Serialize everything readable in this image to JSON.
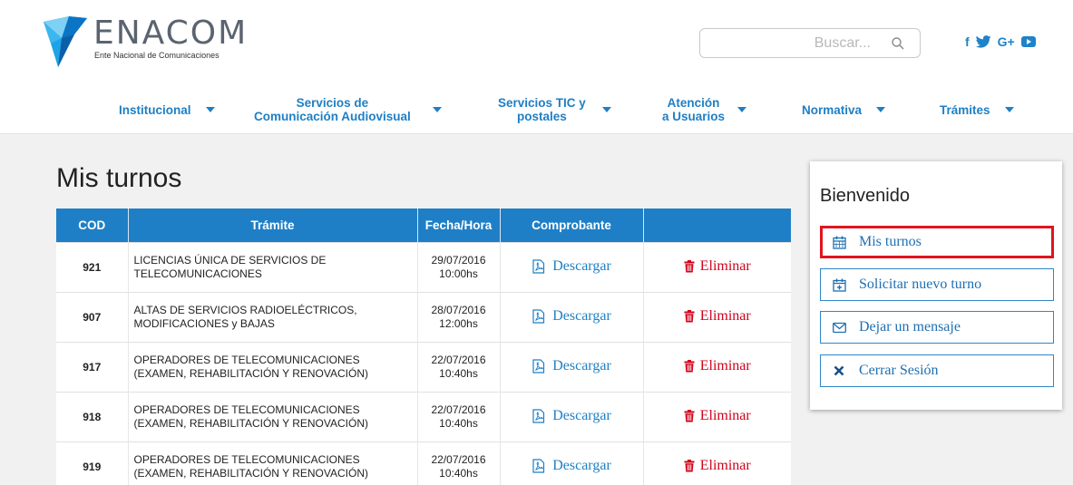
{
  "brand": {
    "name": "ENACOM",
    "subtitle": "Ente Nacional de Comunicaciones",
    "color": "#1e7fc4"
  },
  "search": {
    "placeholder": "Buscar..."
  },
  "social": [
    "f",
    "twitter",
    "G+",
    "youtube"
  ],
  "nav": [
    {
      "label": "Institucional"
    },
    {
      "label": "Servicios de\nComunicación Audiovisual"
    },
    {
      "label": "Servicios TIC y\npostales"
    },
    {
      "label": "Atención\na Usuarios"
    },
    {
      "label": "Normativa"
    },
    {
      "label": "Trámites"
    }
  ],
  "page_title": "Mis turnos",
  "table": {
    "headers": [
      "COD",
      "Trámite",
      "Fecha/Hora",
      "Comprobante",
      ""
    ],
    "download_label": "Descargar",
    "delete_label": "Eliminar",
    "rows": [
      {
        "cod": "921",
        "tramite": "LICENCIAS ÚNICA DE SERVICIOS DE TELECOMUNICACIONES",
        "fecha": "29/07/2016",
        "hora": "10:00hs"
      },
      {
        "cod": "907",
        "tramite": "ALTAS DE SERVICIOS RADIOELÉCTRICOS, MODIFICACIONES y BAJAS",
        "fecha": "28/07/2016",
        "hora": "12:00hs"
      },
      {
        "cod": "917",
        "tramite": "OPERADORES DE TELECOMUNICACIONES (EXAMEN, REHABILITACIÓN Y RENOVACIÓN)",
        "fecha": "22/07/2016",
        "hora": "10:40hs"
      },
      {
        "cod": "918",
        "tramite": "OPERADORES DE TELECOMUNICACIONES (EXAMEN, REHABILITACIÓN Y RENOVACIÓN)",
        "fecha": "22/07/2016",
        "hora": "10:40hs"
      },
      {
        "cod": "919",
        "tramite": "OPERADORES DE TELECOMUNICACIONES (EXAMEN, REHABILITACIÓN Y RENOVACIÓN)",
        "fecha": "22/07/2016",
        "hora": "10:40hs"
      }
    ]
  },
  "panel": {
    "title": "Bienvenido",
    "items": [
      {
        "label": "Mis turnos",
        "icon": "calendar-icon",
        "active": true
      },
      {
        "label": "Solicitar nuevo turno",
        "icon": "calendar-plus-icon",
        "active": false
      },
      {
        "label": "Dejar un mensaje",
        "icon": "envelope-icon",
        "active": false
      },
      {
        "label": "Cerrar Sesión",
        "icon": "close-icon",
        "active": false
      }
    ]
  },
  "colors": {
    "primary_blue": "#1f7fc6",
    "danger_red": "#d0021b",
    "highlight_red": "#e0141e"
  }
}
